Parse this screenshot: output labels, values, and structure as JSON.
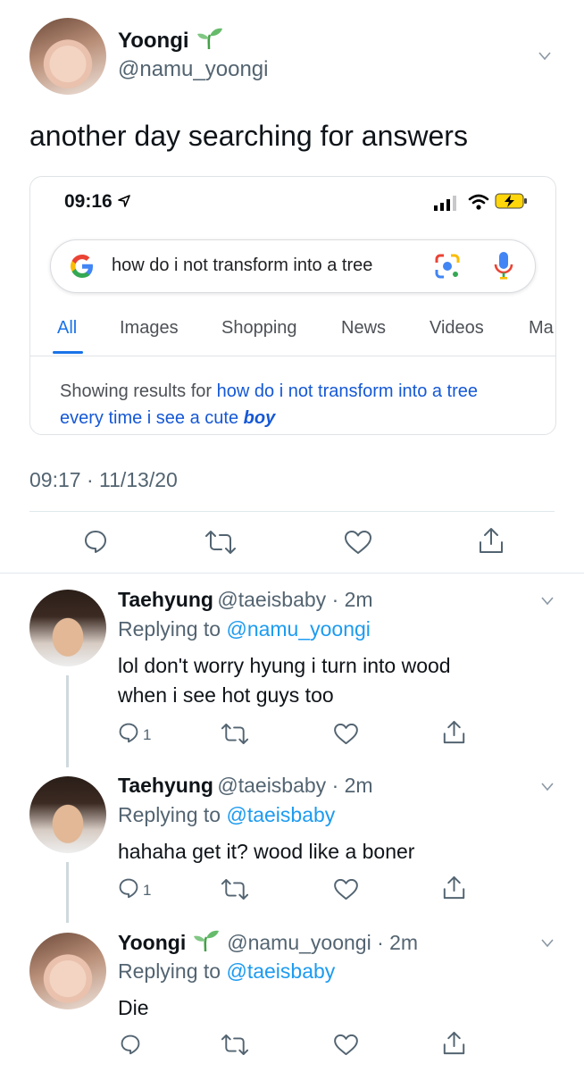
{
  "main_tweet": {
    "display_name": "Yoongi",
    "handle": "@namu_yoongi",
    "text": "another day searching for answers",
    "timestamp": "09:17 · 11/13/20"
  },
  "embedded_screenshot": {
    "status_time": "09:16",
    "search_query": "how do i not transform into a tree",
    "tabs": [
      "All",
      "Images",
      "Shopping",
      "News",
      "Videos",
      "Ma"
    ],
    "showing_results_prefix": "Showing results for ",
    "showing_results_link": "how do i not transform into a tree every time i see a cute ",
    "showing_results_emphasis": "boy"
  },
  "replies": [
    {
      "display_name": "Taehyung",
      "handle_time": "@taeisbaby · 2m",
      "replying_prefix": "Replying to ",
      "replying_to": "@namu_yoongi",
      "text_line1": "lol don't worry hyung i turn into wood",
      "text_line2": "when i see hot guys too",
      "reply_count": "1"
    },
    {
      "display_name": "Taehyung",
      "handle_time": "@taeisbaby · 2m",
      "replying_prefix": "Replying to ",
      "replying_to": "@taeisbaby",
      "text_line1": "hahaha get it? wood like a boner",
      "reply_count": "1"
    },
    {
      "display_name": "Yoongi",
      "handle_time": "@namu_yoongi · 2m",
      "replying_prefix": "Replying to ",
      "replying_to": "@taeisbaby",
      "text_line1": "Die"
    }
  ]
}
